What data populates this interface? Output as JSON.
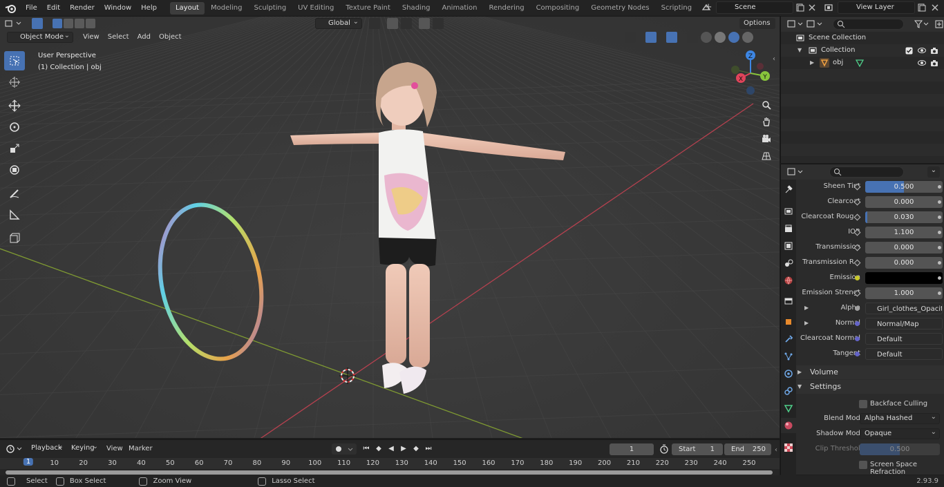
{
  "menu": [
    "File",
    "Edit",
    "Render",
    "Window",
    "Help"
  ],
  "workspaces": [
    "Layout",
    "Modeling",
    "Sculpting",
    "UV Editing",
    "Texture Paint",
    "Shading",
    "Animation",
    "Rendering",
    "Compositing",
    "Geometry Nodes",
    "Scripting"
  ],
  "active_workspace": "Layout",
  "scene_name": "Scene",
  "view_layer": "View Layer",
  "viewport": {
    "mode": "Object Mode",
    "menus": [
      "View",
      "Select",
      "Add",
      "Object"
    ],
    "transform_orientation": "Global",
    "options_label": "Options",
    "info_line1": "User Perspective",
    "info_line2": "(1) Collection | obj",
    "gizmo_axes": {
      "x": "X",
      "y": "Y",
      "z": "Z"
    },
    "colors": {
      "x_axis": "#e0445a",
      "y_axis": "#88c43c",
      "z_axis": "#3d86e3",
      "background": "#3a3a3a"
    }
  },
  "outliner": {
    "search_placeholder": "",
    "rows": [
      {
        "label": "Scene Collection"
      },
      {
        "label": "Collection"
      },
      {
        "label": "obj"
      }
    ]
  },
  "properties": {
    "rows": [
      {
        "label": "Sheen Tint",
        "value": "0.500",
        "fill": 0.5
      },
      {
        "label": "Clearcoat",
        "value": "0.000",
        "fill": 0
      },
      {
        "label": "Clearcoat Roug...",
        "value": "0.030",
        "fill": 0.03
      },
      {
        "label": "IOR",
        "value": "1.100",
        "fill": 0
      },
      {
        "label": "Transmission",
        "value": "0.000",
        "fill": 0
      },
      {
        "label": "Transmission R...",
        "value": "0.000",
        "fill": 0
      },
      {
        "label": "Emission",
        "value": "",
        "fill": 0
      },
      {
        "label": "Emission Strengt",
        "value": "1.000",
        "fill": 0
      },
      {
        "label": "Alpha",
        "value": "Girl_clothes_Opacity..."
      },
      {
        "label": "Normal",
        "value": "Normal/Map"
      },
      {
        "label": "Clearcoat Normal",
        "value": "Default"
      },
      {
        "label": "Tangent",
        "value": "Default"
      }
    ],
    "sections": {
      "volume": "Volume",
      "settings": "Settings"
    },
    "settings": {
      "backface_culling": "Backface Culling",
      "blend_mode_label": "Blend Mode",
      "blend_mode": "Alpha Hashed",
      "shadow_mode_label": "Shadow Mode",
      "shadow_mode": "Opaque",
      "clip_threshold_label": "Clip Threshold",
      "clip_threshold": "0.500",
      "ssr": "Screen Space Refraction"
    },
    "accent": "#4772b3"
  },
  "timeline": {
    "menus": [
      "Playback",
      "Keying",
      "View",
      "Marker"
    ],
    "current_frame": "1",
    "start_label": "Start",
    "start": "1",
    "end_label": "End",
    "end": "250",
    "ticks": [
      "1",
      "10",
      "20",
      "30",
      "40",
      "50",
      "60",
      "70",
      "80",
      "90",
      "100",
      "110",
      "120",
      "130",
      "140",
      "150",
      "160",
      "170",
      "180",
      "190",
      "200",
      "210",
      "220",
      "230",
      "240",
      "250"
    ]
  },
  "status": {
    "select": "Select",
    "box_select": "Box Select",
    "zoom_view": "Zoom View",
    "lasso_select": "Lasso Select",
    "version": "2.93.9"
  }
}
